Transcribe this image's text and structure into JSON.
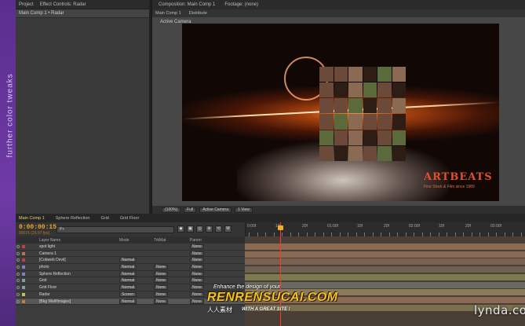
{
  "side_label": "further color tweaks",
  "left_panel": {
    "tabs": [
      "Project",
      "Effect Controls: Radar"
    ],
    "subheader": "Main Comp 1 • Radar"
  },
  "comp_panel": {
    "tabs": [
      "Composition: Main Comp 1",
      "Footage: (none)"
    ],
    "subtabs": [
      "Main Comp 1",
      "Distribute"
    ],
    "active_camera": "Active Camera",
    "logo": "ARTBEATS",
    "logo_tagline": "Fine Stock & Film since 1989",
    "viewer_bar": [
      "(100%)",
      "Full",
      "Active Camera",
      "1 View"
    ]
  },
  "timeline": {
    "tabs": [
      "Main Comp 1",
      "Sphere Reflection",
      "Grid",
      "Grid Floor"
    ],
    "timecode": "0:00:00:15",
    "frame_info": "00015 (29.97 fps)",
    "search_placeholder": "P+",
    "buttons": [
      "◆",
      "▣",
      "◎",
      "⊕",
      "⟲",
      "M"
    ],
    "ruler": [
      "0:00f",
      "10f",
      "20f",
      "01:00f",
      "10f",
      "20f",
      "02:00f",
      "10f",
      "20f",
      "03:00f"
    ],
    "columns": {
      "name": "Layer Name",
      "mode": "Mode",
      "trkmat": "TrkMat",
      "parent": "Parent"
    },
    "layers": [
      {
        "name": "spot light",
        "mode": "",
        "trkmat": "",
        "parent": "None"
      },
      {
        "name": "Camera 1",
        "mode": "",
        "trkmat": "",
        "parent": "None"
      },
      {
        "name": "[Cobweb Devil]",
        "mode": "Normal",
        "trkmat": "",
        "parent": "None"
      },
      {
        "name": "photo",
        "mode": "Normal",
        "trkmat": "None",
        "parent": "None"
      },
      {
        "name": "Sphere Reflection",
        "mode": "Normal",
        "trkmat": "None",
        "parent": "None"
      },
      {
        "name": "Grid",
        "mode": "Normal",
        "trkmat": "None",
        "parent": "None"
      },
      {
        "name": "Grid Floor",
        "mode": "Normal",
        "trkmat": "None",
        "parent": "None"
      },
      {
        "name": "Radar",
        "mode": "Screen",
        "trkmat": "None",
        "parent": "None"
      },
      {
        "name": "[Bkg Wall/Images]",
        "mode": "Normal",
        "trkmat": "None",
        "parent": "None"
      }
    ]
  },
  "watermark": {
    "top": "Enhance the design of your",
    "main": "RENRENSUCAI.COM",
    "cn": "人人素材",
    "sub": "WITH A GREAT SITE !"
  },
  "brand": "lynda.com",
  "colors": {
    "timecode": "#f0a52a",
    "playhead": "#ff3a2a",
    "side_strip": "#6f3aa6",
    "logo": "#e2512a",
    "watermark": "#f2c21e"
  }
}
